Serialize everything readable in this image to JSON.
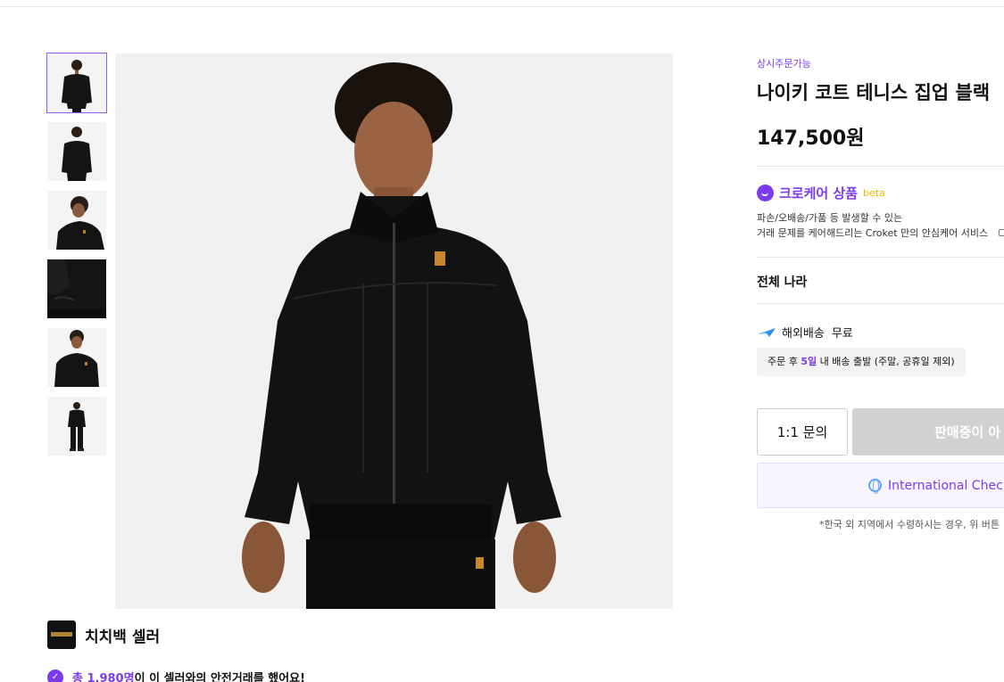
{
  "thumbnails": [
    {
      "icon": "model-front-thumbnail"
    },
    {
      "icon": "model-back-thumbnail"
    },
    {
      "icon": "model-side-thumbnail"
    },
    {
      "icon": "pocket-closeup-thumbnail"
    },
    {
      "icon": "model-half-front-thumbnail"
    },
    {
      "icon": "model-full-body-thumbnail"
    }
  ],
  "product": {
    "badge": "상시주문가능",
    "title": "나이키 코트 테니스 집업 블랙",
    "price": "147,500원"
  },
  "care": {
    "title": "크로케어 상품",
    "beta": "beta",
    "desc_line1": "파손/오배송/가품 등 발생할 수 있는",
    "desc_line2": "거래 문제를 케어해드리는 Croket 만의 안심케어 서비스"
  },
  "shipping": {
    "country": "전체 나라",
    "label": "해외배송",
    "free": "무료",
    "note_prefix": "주문 후",
    "note_days": "5일",
    "note_suffix": "내 배송 출발 (주말, 공휴일 제외)"
  },
  "actions": {
    "inquiry": "1:1 문의",
    "soldout": "판매중이 아",
    "intl_checkout": "International Checko",
    "intl_note": "*한국 외 지역에서 수령하시는 경우, 위 버튼"
  },
  "seller": {
    "name": "치치백 셀러",
    "safe_total": "총 1,980명",
    "safe_text": "이 이 셀러와의 안전거래를 했어요!"
  },
  "colors": {
    "accent": "#7c3aed",
    "beta": "#f2b705",
    "disabled": "#d1d1d1"
  }
}
